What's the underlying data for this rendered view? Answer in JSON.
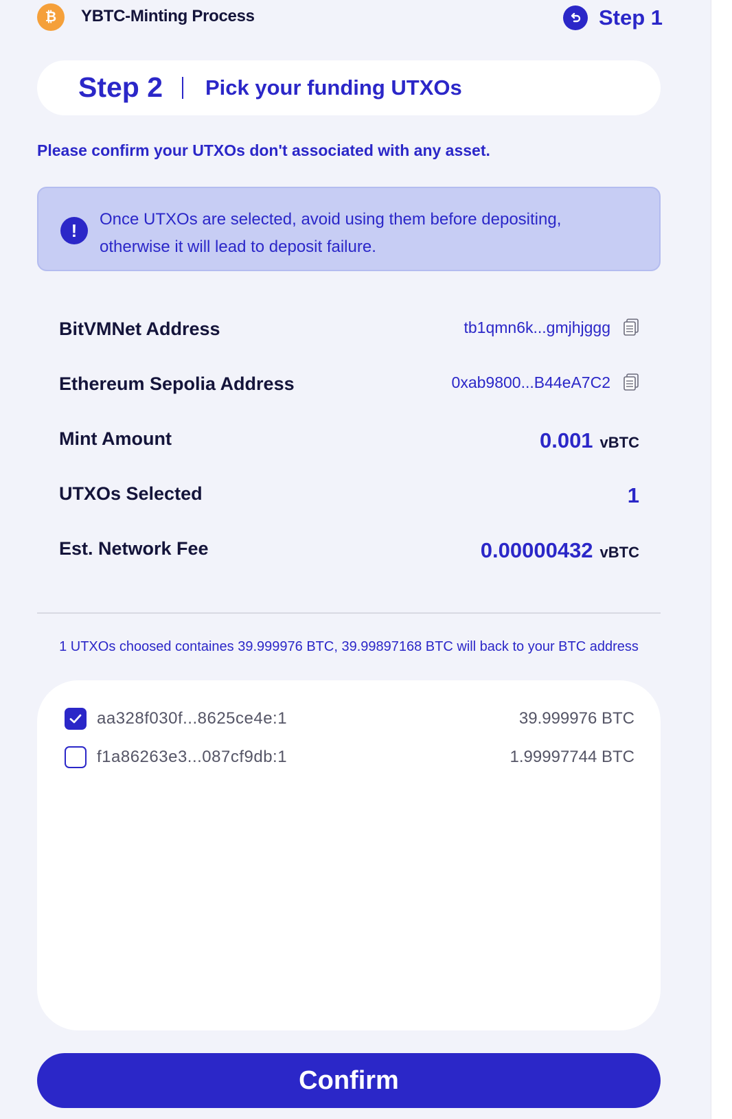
{
  "header": {
    "app_title": "YBTC-Minting Process",
    "back_label": "Step 1",
    "logo_icon": "bitcoin-icon",
    "back_icon": "back-arrow-icon"
  },
  "step": {
    "number": "Step 2",
    "title": "Pick your funding UTXOs"
  },
  "confirm_note": "Please confirm your UTXOs don't associated with any asset.",
  "warning": {
    "icon": "exclamation-icon",
    "text": "Once UTXOs are selected, avoid using them before depositing, otherwise it will lead to deposit failure."
  },
  "details": {
    "bitvmnet_label": "BitVMNet Address",
    "bitvmnet_value": "tb1qmn6k...gmjhjggg",
    "eth_label": "Ethereum Sepolia Address",
    "eth_value": "0xab9800...B44eA7C2",
    "mint_label": "Mint Amount",
    "mint_value": "0.001",
    "mint_unit": "vBTC",
    "utxos_label": "UTXOs Selected",
    "utxos_value": "1",
    "fee_label": "Est. Network Fee",
    "fee_value": "0.00000432",
    "fee_unit": "vBTC"
  },
  "summary": "1 UTXOs choosed containes 39.999976 BTC, 39.99897168 BTC will back to your BTC address",
  "utxos": [
    {
      "id": "aa328f030f...8625ce4e:1",
      "amount": "39.999976 BTC",
      "checked": true
    },
    {
      "id": "f1a86263e3...087cf9db:1",
      "amount": "1.99997744 BTC",
      "checked": false
    }
  ],
  "confirm_label": "Confirm",
  "colors": {
    "accent": "#2b27c8",
    "background": "#f2f3fa",
    "warning_bg": "#c7cdf4",
    "bitcoin": "#f5a03a"
  }
}
